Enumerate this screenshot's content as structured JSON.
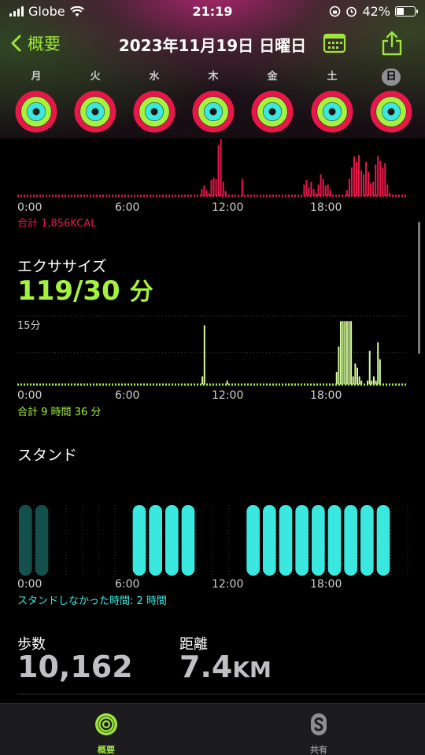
{
  "status": {
    "carrier": "Globe",
    "time": "21:19",
    "battery": "42%",
    "battery_level": 0.42
  },
  "nav": {
    "back_label": "概要",
    "title": "2023年11月19日 日曜日"
  },
  "week": [
    {
      "label": "月",
      "today": false
    },
    {
      "label": "火",
      "today": false
    },
    {
      "label": "水",
      "today": false
    },
    {
      "label": "木",
      "today": false
    },
    {
      "label": "金",
      "today": false
    },
    {
      "label": "土",
      "today": false
    },
    {
      "label": "日",
      "today": true
    }
  ],
  "colors": {
    "move": "#e8174a",
    "exercise": "#a4f23d",
    "stand": "#3ae8e0",
    "accent": "#9ee53f"
  },
  "move_chart": {
    "ticks": [
      "0:00",
      "6:00",
      "12:00",
      "18:00"
    ],
    "summary": "合計 1,856KCAL"
  },
  "exercise": {
    "title": "エクササイズ",
    "value": "119/30",
    "unit": "分",
    "y_label": "15分",
    "ticks": [
      "0:00",
      "6:00",
      "12:00",
      "18:00"
    ],
    "summary": "合計 9 時間 36 分"
  },
  "stand": {
    "title": "スタンド",
    "ticks": [
      "0:00",
      "6:00",
      "12:00",
      "18:00"
    ],
    "summary": "スタンドしなかった時間: 2 時間"
  },
  "steps": {
    "label": "歩数",
    "value": "10,162"
  },
  "distance": {
    "label": "距離",
    "value": "7.4",
    "unit": "KM"
  },
  "tabs": [
    {
      "label": "概要",
      "active": true,
      "icon": "activity-rings-icon"
    },
    {
      "label": "共有",
      "active": false,
      "icon": "sharing-icon"
    }
  ],
  "chart_data": [
    {
      "type": "bar",
      "series": [
        {
          "name": "Move",
          "values": [
            0,
            0,
            0,
            0,
            0,
            0,
            0,
            0,
            0,
            0,
            0,
            0,
            0,
            0,
            0,
            0,
            0,
            0,
            0,
            0,
            0,
            0,
            0,
            0,
            0,
            0,
            0,
            0,
            0,
            0,
            0,
            0,
            0,
            0,
            0,
            0,
            0,
            0,
            0,
            0,
            0,
            0,
            0,
            0,
            0,
            0,
            0,
            0,
            0,
            0,
            0,
            0,
            0,
            0,
            0,
            0,
            0,
            0,
            0,
            0,
            0,
            0,
            0,
            0,
            0,
            0,
            0,
            0,
            0,
            0,
            0,
            0,
            0,
            0,
            0,
            0,
            0,
            0.12,
            0.18,
            0.1,
            0.05,
            0.28,
            0.32,
            0.3,
            0.9,
            1.0,
            0.25,
            0.08,
            0,
            0,
            0,
            0,
            0,
            0,
            0.3,
            0,
            0,
            0,
            0,
            0,
            0,
            0,
            0,
            0,
            0,
            0,
            0,
            0,
            0,
            0,
            0,
            0,
            0,
            0,
            0,
            0,
            0,
            0,
            0,
            0,
            0.2,
            0.28,
            0.15,
            0.25,
            0.12,
            0.05,
            0.2,
            0.38,
            0.3,
            0.18,
            0.2,
            0.1,
            0,
            0,
            0,
            0,
            0,
            0,
            0.1,
            0.3,
            0.5,
            0.7,
            0.6,
            0.72,
            0.45,
            0.38,
            0.6,
            0.42,
            0.22,
            0.25,
            0.55,
            0.7,
            0.62,
            0.5,
            0.58,
            0.2,
            0.05,
            0,
            0,
            0,
            0,
            0,
            0,
            0
          ]
        }
      ],
      "xlabel": "",
      "ylabel": ""
    },
    {
      "type": "bar",
      "series": [
        {
          "name": "Exercise",
          "values": [
            0,
            0,
            0,
            0,
            0,
            0,
            0,
            0,
            0,
            0,
            0,
            0,
            0,
            0,
            0,
            0,
            0,
            0,
            0,
            0,
            0,
            0,
            0,
            0,
            0,
            0,
            0,
            0,
            0,
            0,
            0,
            0,
            0,
            0,
            0,
            0,
            0,
            0,
            0,
            0,
            0,
            0,
            0,
            0,
            0,
            0,
            0,
            0,
            0,
            0,
            0,
            0,
            0,
            0,
            0,
            0,
            0,
            0,
            0,
            0,
            0,
            0,
            0,
            0,
            0,
            0,
            0,
            0,
            0,
            0,
            0,
            0,
            0,
            0,
            0,
            0,
            0,
            0,
            0,
            0,
            0,
            0,
            0,
            0,
            0,
            0,
            0,
            0,
            0,
            2,
            14,
            0,
            0,
            0,
            0,
            0,
            0,
            0,
            0,
            0,
            0,
            1,
            0,
            0,
            0,
            0,
            0,
            0,
            0,
            0,
            0,
            0,
            0,
            0,
            0,
            0,
            0,
            0,
            0,
            0,
            0,
            0,
            0,
            0,
            0,
            0,
            0,
            0,
            0,
            0,
            0,
            0,
            0,
            0,
            0,
            0,
            0,
            0,
            0,
            0,
            0,
            0,
            0,
            0,
            0,
            0,
            0,
            0,
            0,
            0,
            0,
            0,
            0,
            0,
            3,
            9,
            15,
            15,
            15,
            15,
            15,
            15,
            2,
            5,
            4,
            2,
            1,
            0,
            0,
            1,
            8,
            1,
            2,
            1,
            10,
            6,
            0,
            0,
            0,
            0,
            0,
            0,
            0,
            0,
            0,
            0,
            0,
            0,
            0
          ]
        }
      ],
      "ylim": [
        0,
        15
      ],
      "xlabel": "",
      "ylabel": "15分"
    },
    {
      "type": "bar",
      "series": [
        {
          "name": "Stand",
          "values": [
            1,
            1,
            0,
            0,
            0,
            0,
            0,
            1,
            1,
            1,
            1,
            0,
            0,
            0,
            1,
            1,
            1,
            1,
            1,
            1,
            1,
            1,
            1,
            0
          ]
        }
      ],
      "categories": [
        "0",
        "1",
        "2",
        "3",
        "4",
        "5",
        "6",
        "7",
        "8",
        "9",
        "10",
        "11",
        "12",
        "13",
        "14",
        "15",
        "16",
        "17",
        "18",
        "19",
        "20",
        "21",
        "22",
        "23"
      ],
      "xlabel": "",
      "ylabel": ""
    }
  ]
}
